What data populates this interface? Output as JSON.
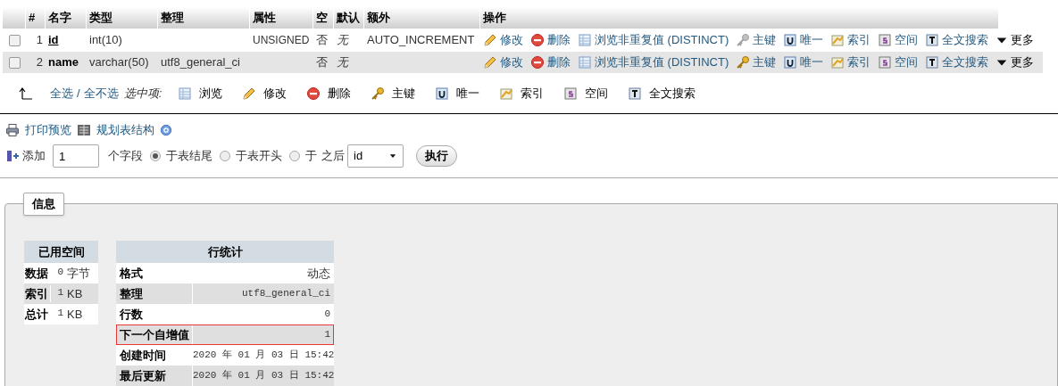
{
  "columns": [
    "#",
    "名字",
    "类型",
    "整理",
    "属性",
    "空",
    "默认",
    "额外",
    "操作"
  ],
  "fields": [
    {
      "checked": false,
      "number": "1",
      "name": "id",
      "name_underlined": true,
      "type": "int(10)",
      "attributes": "UNSIGNED",
      "null": "否",
      "default": "无",
      "extra": "AUTO_INCREMENT",
      "actions": [
        {
          "kind": "edit",
          "label": "修改",
          "disabled": false
        },
        {
          "kind": "drop",
          "label": "删除",
          "disabled": false
        },
        {
          "kind": "browse",
          "label": "浏览非重复值 (DISTINCT)",
          "disabled": false
        },
        {
          "kind": "primary",
          "label": "主键",
          "disabled": true
        },
        {
          "kind": "unique",
          "label": "唯一",
          "disabled": false
        },
        {
          "kind": "index",
          "label": "索引",
          "disabled": false
        },
        {
          "kind": "spatial",
          "label": "空间",
          "disabled": false
        },
        {
          "kind": "fulltext",
          "label": "全文搜索",
          "disabled": false
        },
        {
          "kind": "more",
          "label": "更多",
          "disabled": false
        }
      ]
    },
    {
      "checked": false,
      "number": "2",
      "name": "name",
      "name_underlined": false,
      "type": "varchar(50)",
      "collation": "utf8_general_ci",
      "null": "否",
      "default": "无",
      "actions": [
        {
          "kind": "edit",
          "label": "修改",
          "disabled": false
        },
        {
          "kind": "drop",
          "label": "删除",
          "disabled": false
        },
        {
          "kind": "browse",
          "label": "浏览非重复值 (DISTINCT)",
          "disabled": false
        },
        {
          "kind": "primary",
          "label": "主键",
          "disabled": false
        },
        {
          "kind": "unique",
          "label": "唯一",
          "disabled": false
        },
        {
          "kind": "index",
          "label": "索引",
          "disabled": false
        },
        {
          "kind": "spatial",
          "label": "空间",
          "disabled": false
        },
        {
          "kind": "fulltext",
          "label": "全文搜索",
          "disabled": false
        },
        {
          "kind": "more",
          "label": "更多",
          "disabled": false
        }
      ]
    }
  ],
  "bulk": {
    "select_all": "全选",
    "separator": "/",
    "deselect_all": "全不选",
    "with_selected": "选中项:",
    "actions": [
      {
        "kind": "browse",
        "label": "浏览"
      },
      {
        "kind": "edit",
        "label": "修改"
      },
      {
        "kind": "drop",
        "label": "删除"
      },
      {
        "kind": "primary",
        "label": "主键"
      },
      {
        "kind": "unique",
        "label": "唯一"
      },
      {
        "kind": "index",
        "label": "索引"
      },
      {
        "kind": "spatial",
        "label": "空间"
      },
      {
        "kind": "fulltext",
        "label": "全文搜索"
      }
    ]
  },
  "links": [
    {
      "kind": "print",
      "label": "打印预览"
    },
    {
      "kind": "propose",
      "label": "规划表结构"
    }
  ],
  "add_columns": {
    "label": "添加",
    "value": "1",
    "unit": "个字段",
    "positions": [
      {
        "label": "于表结尾",
        "selected": true
      },
      {
        "label": "于表开头",
        "selected": false
      },
      {
        "label": "于",
        "selected": false
      }
    ],
    "after_label": "之后",
    "after_value": "id",
    "button": "执行"
  },
  "info": {
    "legend": "信息",
    "space": {
      "title": "已用空间",
      "rows": [
        {
          "label": "数据",
          "value": "0",
          "unit": "字节"
        },
        {
          "label": "索引",
          "value": "1",
          "unit": "KB"
        },
        {
          "label": "总计",
          "value": "1",
          "unit": "KB"
        }
      ]
    },
    "stats": {
      "title": "行统计",
      "rows": [
        {
          "label": "格式",
          "value": "动态",
          "mono": false,
          "highlighted": false
        },
        {
          "label": "整理",
          "value": "utf8_general_ci",
          "mono": true,
          "highlighted": false
        },
        {
          "label": "行数",
          "value": "0",
          "mono": true,
          "highlighted": false
        },
        {
          "label": "下一个自增值",
          "value": "1",
          "mono": true,
          "highlighted": true
        },
        {
          "label": "创建时间",
          "value": "2020 年 01 月 03 日 15:42",
          "mono": true,
          "highlighted": false
        },
        {
          "label": "最后更新",
          "value": "2020 年 01 月 03 日 15:42",
          "mono": true,
          "highlighted": false
        }
      ]
    }
  }
}
